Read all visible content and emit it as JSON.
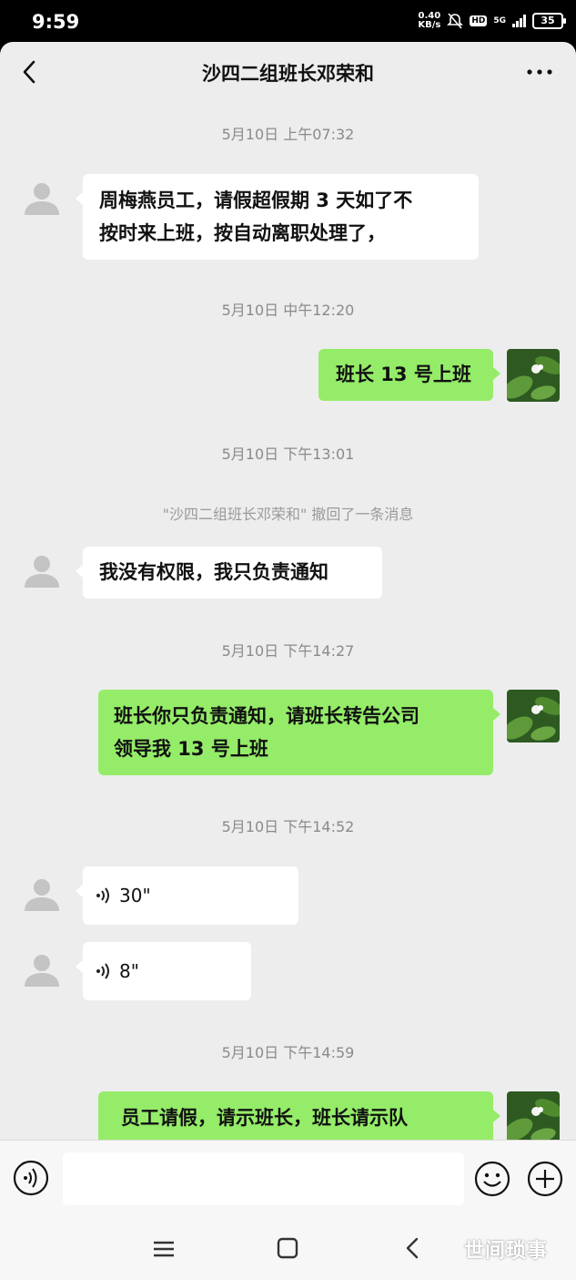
{
  "status_bar": {
    "time": "9:59",
    "net_speed_value": "0.40",
    "net_speed_unit": "KB/s",
    "hd": "HD",
    "network": "5G",
    "battery": "35"
  },
  "header": {
    "title": "沙四二组班长邓荣和"
  },
  "messages": {
    "ts1": "5月10日 上午07:32",
    "m1_line1": "周梅燕员工，请假超假期 3 天如了不",
    "m1_line2": "按时来上班，按自动离职处理了，",
    "ts2": "5月10日 中午12:20",
    "m2": "班长 13 号上班",
    "ts3": "5月10日 下午13:01",
    "recall": "\"沙四二组班长邓荣和\" 撤回了一条消息",
    "m3": "我没有权限，我只负责通知",
    "ts4": "5月10日 下午14:27",
    "m4_line1": "班长你只负责通知，请班长转告公司",
    "m4_line2": "领导我 13 号上班",
    "ts5": "5月10日 下午14:52",
    "v1": "30\"",
    "v2": "8\"",
    "ts6": "5月10日 下午14:59",
    "m5_line1": "员工请假，请示班长，班长请示队"
  },
  "watermark": "世间琐事",
  "colors": {
    "chat_bg": "#ededed",
    "outgoing_bubble": "#95ec69",
    "incoming_bubble": "#ffffff"
  },
  "icons": {
    "back": "chevron-left-icon",
    "more": "more-dots-icon",
    "voice_input": "voice-icon",
    "emoji": "emoji-icon",
    "plus": "plus-icon"
  }
}
